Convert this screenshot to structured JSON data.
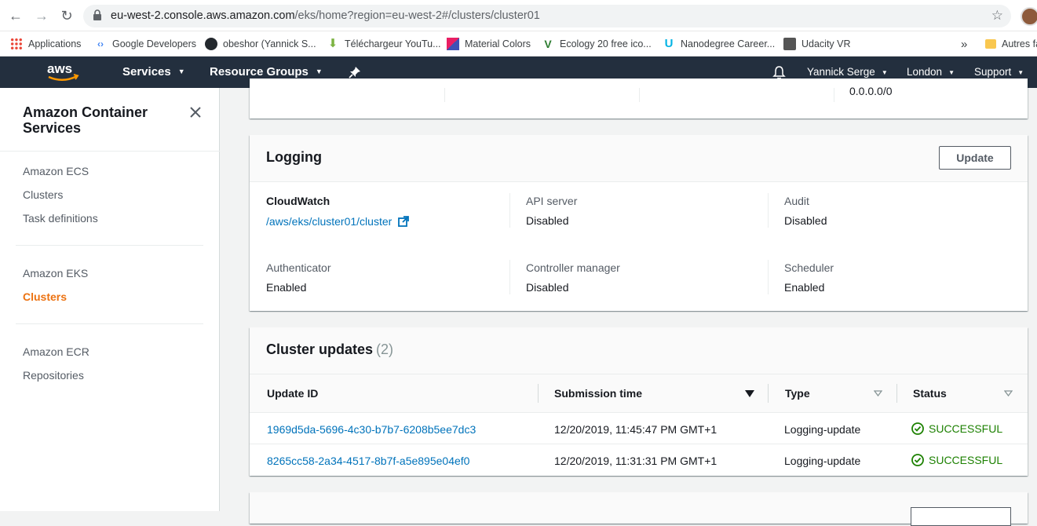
{
  "browser": {
    "url_host": "eu-west-2.console.aws.amazon.com",
    "url_path": "/eks/home?region=eu-west-2#/clusters/cluster01",
    "bookmarks": [
      {
        "label": "Applications",
        "icon": "apps-grid-icon"
      },
      {
        "label": "Google Developers",
        "icon": "google-developers-icon"
      },
      {
        "label": "obeshor (Yannick S...",
        "icon": "github-icon"
      },
      {
        "label": "Téléchargeur YouTu...",
        "icon": "download-arrow-icon"
      },
      {
        "label": "Material Colors",
        "icon": "material-colors-icon"
      },
      {
        "label": "Ecology 20 free ico...",
        "icon": "ecology-icon"
      },
      {
        "label": "Nanodegree Career...",
        "icon": "udacity-icon"
      },
      {
        "label": "Udacity VR",
        "icon": "cube-icon"
      }
    ],
    "overflow_label": "»",
    "other_bookmarks": "Autres fa"
  },
  "aws_header": {
    "services": "Services",
    "resource_groups": "Resource Groups",
    "user": "Yannick Serge",
    "region": "London",
    "support": "Support"
  },
  "sidebar": {
    "title": "Amazon Container Services",
    "groups": [
      {
        "items": [
          "Amazon ECS",
          "Clusters",
          "Task definitions"
        ]
      },
      {
        "items": [
          "Amazon EKS",
          "Clusters"
        ]
      },
      {
        "items": [
          "Amazon ECR",
          "Repositories"
        ]
      }
    ],
    "active_item": "Clusters"
  },
  "top_panel": {
    "partial_value": "0.0.0.0/0"
  },
  "logging": {
    "title": "Logging",
    "update_label": "Update",
    "cloudwatch_label": "CloudWatch",
    "cloudwatch_link": "/aws/eks/cluster01/cluster",
    "items": [
      {
        "label": "API server",
        "value": "Disabled"
      },
      {
        "label": "Audit",
        "value": "Disabled"
      },
      {
        "label": "Authenticator",
        "value": "Enabled"
      },
      {
        "label": "Controller manager",
        "value": "Disabled"
      },
      {
        "label": "Scheduler",
        "value": "Enabled"
      }
    ]
  },
  "cluster_updates": {
    "title": "Cluster updates",
    "count": "(2)",
    "columns": [
      "Update ID",
      "Submission time",
      "Type",
      "Status"
    ],
    "rows": [
      {
        "id": "1969d5da-5696-4c30-b7b7-6208b5ee7dc3",
        "time": "12/20/2019, 11:45:47 PM GMT+1",
        "type": "Logging-update",
        "status": "SUCCESSFUL"
      },
      {
        "id": "8265cc58-2a34-4517-8b7f-a5e895e04ef0",
        "time": "12/20/2019, 11:31:31 PM GMT+1",
        "type": "Logging-update",
        "status": "SUCCESSFUL"
      }
    ]
  },
  "colors": {
    "aws_nav": "#232f3e",
    "link": "#0073bb",
    "active": "#ec7211",
    "success": "#1d8102"
  }
}
